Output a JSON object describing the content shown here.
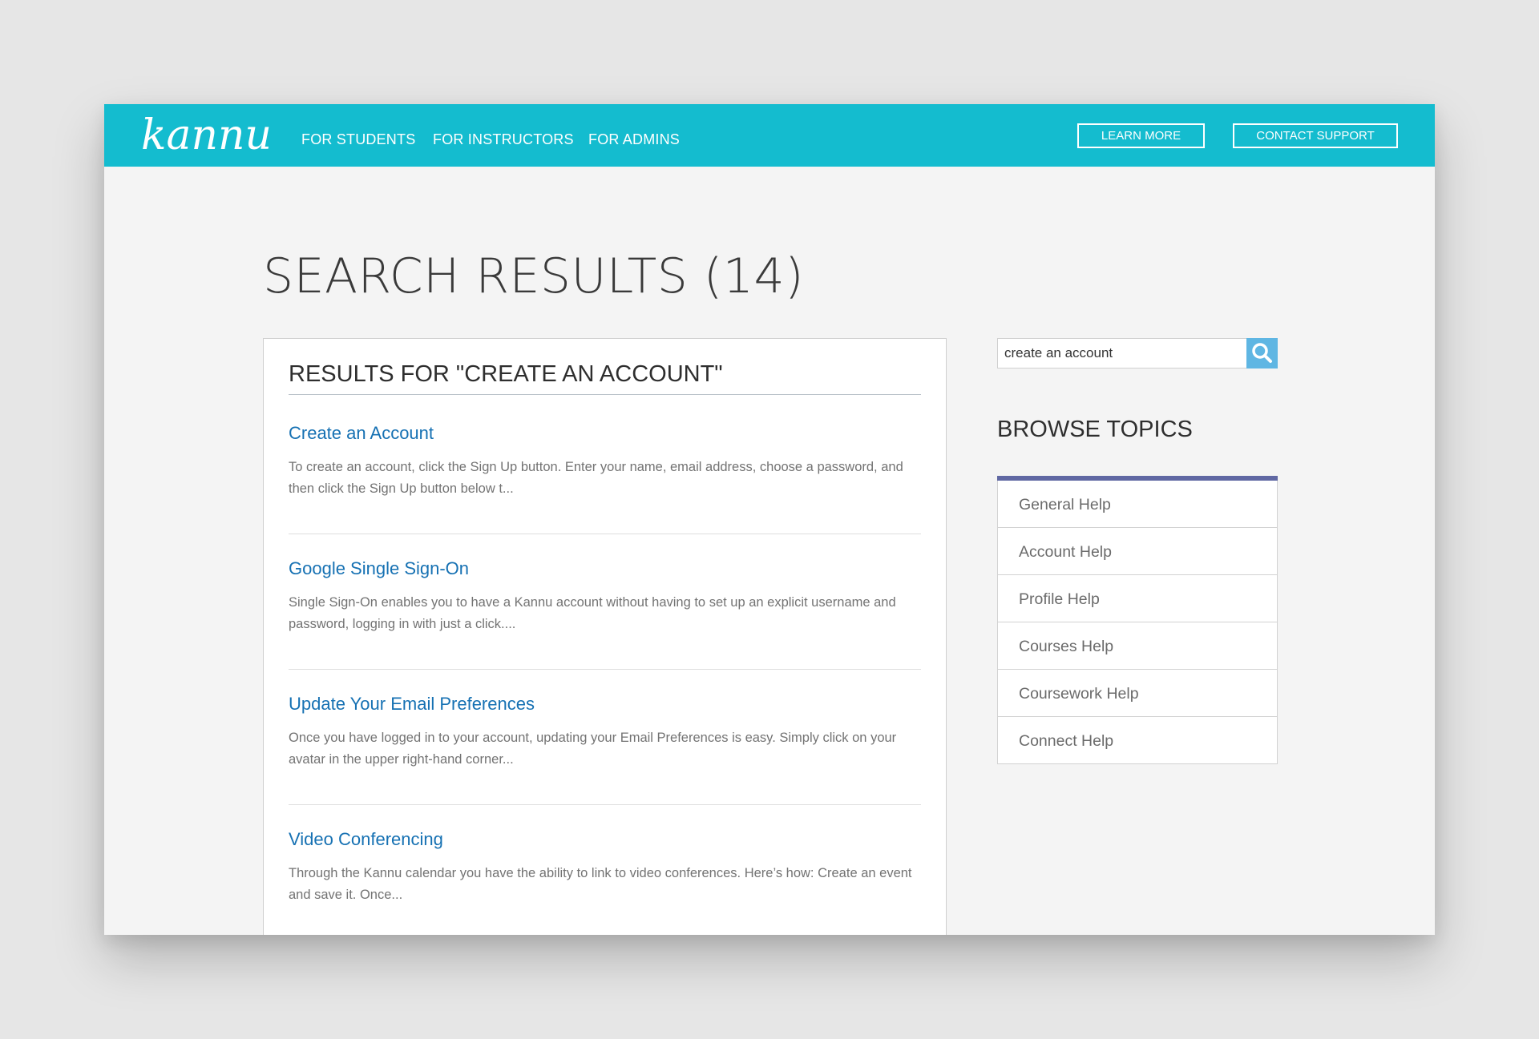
{
  "header": {
    "logo_text": "kannu",
    "nav": [
      {
        "label": "FOR STUDENTS"
      },
      {
        "label": "FOR INSTRUCTORS"
      },
      {
        "label": "FOR ADMINS"
      }
    ],
    "learn_more_label": "LEARN MORE",
    "contact_support_label": "CONTACT SUPPORT",
    "brand_color": "#14bccf"
  },
  "page": {
    "title": "SEARCH RESULTS (14)"
  },
  "results": {
    "heading": "RESULTS FOR \"CREATE AN ACCOUNT\"",
    "items": [
      {
        "title": "Create an Account",
        "snippet": "To create an account, click the Sign Up button. Enter your name, email address, choose a password, and then click the Sign Up button below t..."
      },
      {
        "title": "Google Single Sign-On",
        "snippet": "Single Sign-On enables you to have a Kannu account without having to set up an explicit username and password, logging in with just a click...."
      },
      {
        "title": "Update Your Email Preferences",
        "snippet": "Once you have logged in to your account, updating your Email Preferences is easy. Simply click on your avatar in the upper right-hand corner..."
      },
      {
        "title": "Video Conferencing",
        "snippet": "Through the Kannu calendar you have the ability to link to video conferences. Here’s how: Create an event and save it. Once..."
      }
    ]
  },
  "sidebar": {
    "search_value": "create an account",
    "search_icon": "search-icon",
    "browse_heading": "BROWSE TOPICS",
    "topics": [
      {
        "label": "General Help"
      },
      {
        "label": "Account Help"
      },
      {
        "label": "Profile Help"
      },
      {
        "label": "Courses Help"
      },
      {
        "label": "Coursework Help"
      },
      {
        "label": "Connect Help"
      }
    ],
    "topics_accent_color": "#6068a3"
  }
}
